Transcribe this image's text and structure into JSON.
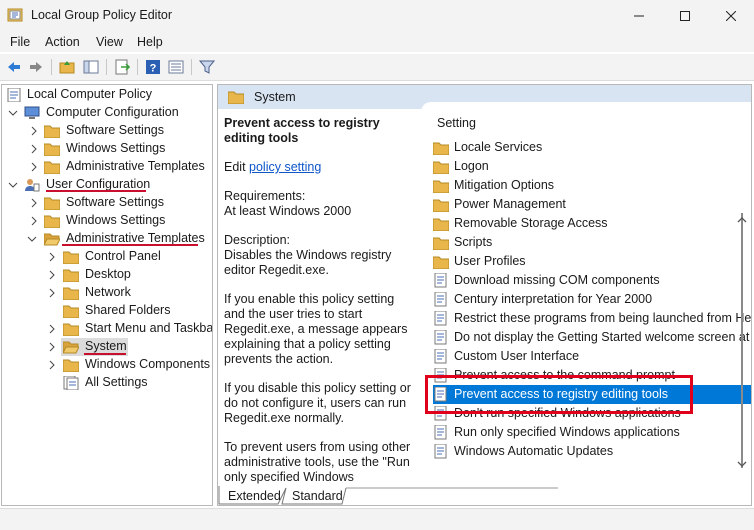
{
  "window": {
    "title": "Local Group Policy Editor",
    "controls": [
      "minimize",
      "maximize",
      "close"
    ]
  },
  "menu": {
    "items": [
      "File",
      "Action",
      "View",
      "Help"
    ]
  },
  "toolbar": {
    "icons": [
      "back-arrow-icon",
      "forward-arrow-icon",
      "folder-up-icon",
      "show-hide-tree-icon",
      "export-list-icon",
      "help-icon",
      "extended-view-icon",
      "filter-icon"
    ]
  },
  "tree": {
    "items": [
      {
        "label": "Local Computer Policy"
      },
      {
        "label": "Computer Configuration"
      },
      {
        "label": "Software Settings"
      },
      {
        "label": "Windows Settings"
      },
      {
        "label": "Administrative Templates"
      },
      {
        "label": "User Configuration"
      },
      {
        "label": "Software Settings"
      },
      {
        "label": "Windows Settings"
      },
      {
        "label": "Administrative Templates"
      },
      {
        "label": "Control Panel"
      },
      {
        "label": "Desktop"
      },
      {
        "label": "Network"
      },
      {
        "label": "Shared Folders"
      },
      {
        "label": "Start Menu and Taskbar"
      },
      {
        "label": "System"
      },
      {
        "label": "Windows Components"
      },
      {
        "label": "All Settings"
      }
    ]
  },
  "pane": {
    "folder_title": "System"
  },
  "description": {
    "title": "Prevent access to registry editing tools",
    "edit_prefix": "Edit",
    "edit_link": "policy setting",
    "requirements_label": "Requirements:",
    "requirements_value": "At least Windows 2000",
    "description_label": "Description:",
    "description_text": "Disables the Windows registry editor Regedit.exe.",
    "para_enable": "If you enable this policy setting and the user tries to start Regedit.exe, a message appears explaining that a policy setting prevents the action.",
    "para_disable": "If you disable this policy setting or do not configure it, users can run Regedit.exe normally.",
    "para_prevent": "To prevent users from using other administrative tools, use the \"Run only specified Windows"
  },
  "settings": {
    "column_header": "Setting",
    "items": [
      {
        "label": "Locale Services",
        "type": "folder"
      },
      {
        "label": "Logon",
        "type": "folder"
      },
      {
        "label": "Mitigation Options",
        "type": "folder"
      },
      {
        "label": "Power Management",
        "type": "folder"
      },
      {
        "label": "Removable Storage Access",
        "type": "folder"
      },
      {
        "label": "Scripts",
        "type": "folder"
      },
      {
        "label": "User Profiles",
        "type": "folder"
      },
      {
        "label": "Download missing COM components",
        "type": "policy"
      },
      {
        "label": "Century interpretation for Year 2000",
        "type": "policy"
      },
      {
        "label": "Restrict these programs from being launched from Help",
        "type": "policy"
      },
      {
        "label": "Do not display the Getting Started welcome screen at logon",
        "type": "policy"
      },
      {
        "label": "Custom User Interface",
        "type": "policy"
      },
      {
        "label": "Prevent access to the command prompt",
        "type": "policy"
      },
      {
        "label": "Prevent access to registry editing tools",
        "type": "policy",
        "selected": true
      },
      {
        "label": "Don't run specified Windows applications",
        "type": "policy"
      },
      {
        "label": "Run only specified Windows applications",
        "type": "policy"
      },
      {
        "label": "Windows Automatic Updates",
        "type": "policy"
      }
    ]
  },
  "tabs": {
    "items": [
      "Extended",
      "Standard"
    ],
    "active": "Extended"
  },
  "colors": {
    "selection": "#0078d7",
    "highlight_box": "#e0001b",
    "underline": "#c8102e",
    "header_band": "#d9e4f3",
    "link": "#0f56c8",
    "folder": "#e8b64a"
  }
}
